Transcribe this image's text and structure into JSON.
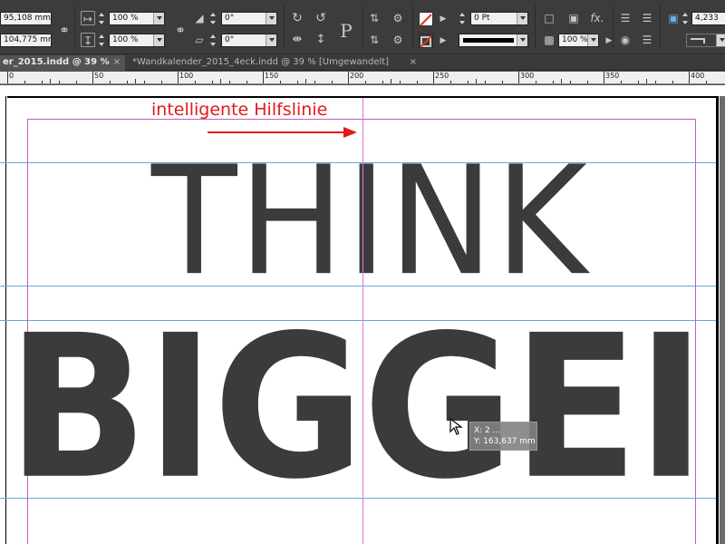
{
  "control_panel": {
    "x_value": "95,108 mm",
    "y_value": "104,775 mm",
    "scale_x": "100 %",
    "scale_y": "100 %",
    "rotation": "0°",
    "shear": "0°",
    "stroke_weight": "0 Pt",
    "opacity": "100 %",
    "partial_value": "4,233",
    "text_icon": "P",
    "fx_icon": "fx."
  },
  "tabs": [
    {
      "label": "er_2015.indd @ 39 %",
      "close": "×"
    },
    {
      "label": "*Wandkalender_2015_4eck.indd @ 39 % [Umgewandelt]",
      "close": "×"
    }
  ],
  "ruler": {
    "labels": [
      "0",
      "50",
      "100",
      "150",
      "200",
      "250",
      "300",
      "350",
      "400"
    ]
  },
  "canvas": {
    "annotation": "intelligente Hilfslinie",
    "headline_light": "THINK",
    "headline_bold": "BIGGEI",
    "tooltip_x": "X: 2 ...",
    "tooltip_y": "Y: 163,637 mm"
  },
  "colors": {
    "annotation": "#e21a1a",
    "guide": "#5aaed8",
    "margin": "#c45ac4",
    "text": "#3b3b3d"
  }
}
